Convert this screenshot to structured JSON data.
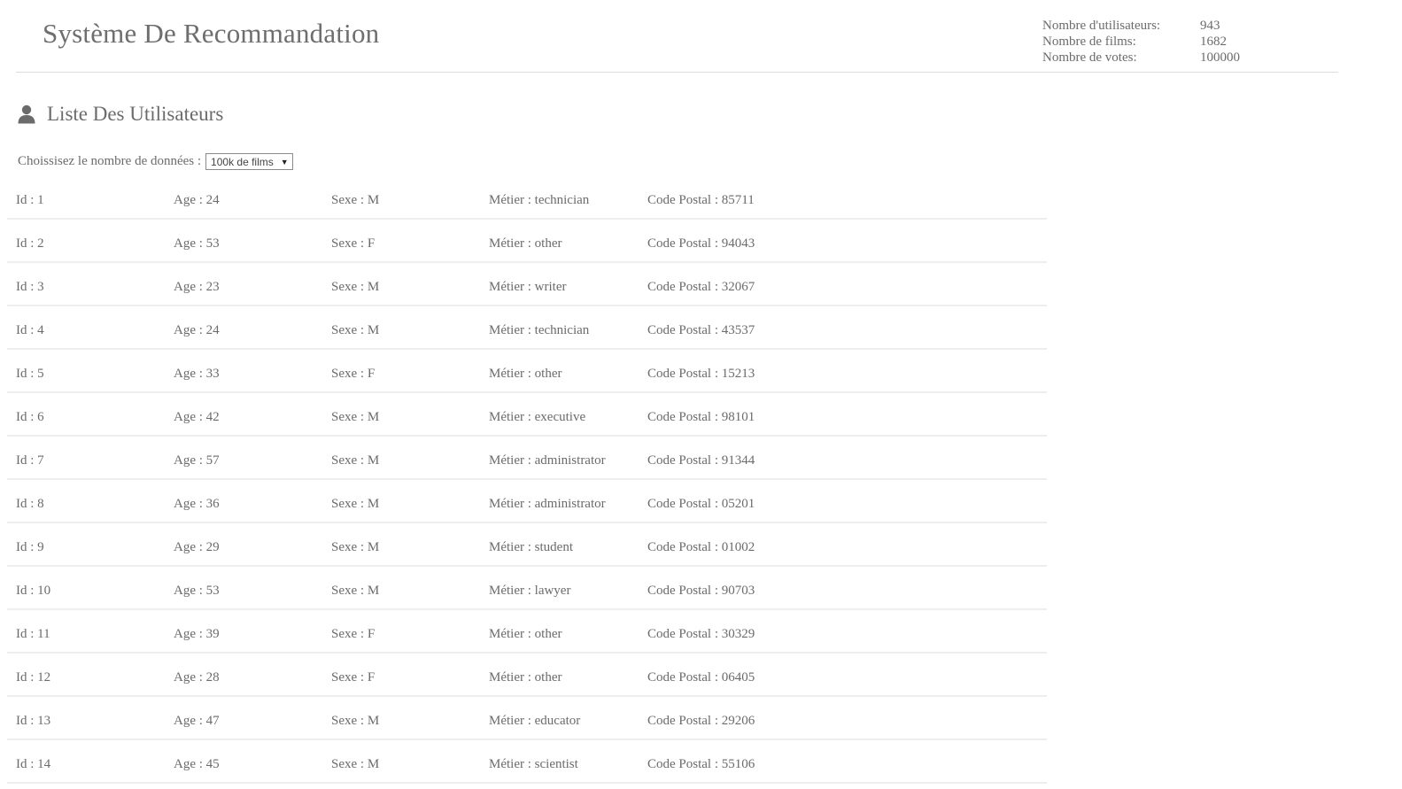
{
  "header": {
    "title": "Système De Recommandation",
    "stats": [
      {
        "label": "Nombre d'utilisateurs:",
        "value": "943"
      },
      {
        "label": "Nombre de films:",
        "value": "1682"
      },
      {
        "label": "Nombre de votes:",
        "value": "100000"
      }
    ]
  },
  "section": {
    "icon": "user-icon",
    "title": "Liste Des Utilisateurs",
    "select_label": "Choissisez le nombre de données :",
    "select_value": "100k de films"
  },
  "users": [
    {
      "id": "Id : 1",
      "age": "Age : 24",
      "sexe": "Sexe : M",
      "metier": "Métier : technician",
      "code_postal": "Code Postal : 85711"
    },
    {
      "id": "Id : 2",
      "age": "Age : 53",
      "sexe": "Sexe : F",
      "metier": "Métier : other",
      "code_postal": "Code Postal : 94043"
    },
    {
      "id": "Id : 3",
      "age": "Age : 23",
      "sexe": "Sexe : M",
      "metier": "Métier : writer",
      "code_postal": "Code Postal : 32067"
    },
    {
      "id": "Id : 4",
      "age": "Age : 24",
      "sexe": "Sexe : M",
      "metier": "Métier : technician",
      "code_postal": "Code Postal : 43537"
    },
    {
      "id": "Id : 5",
      "age": "Age : 33",
      "sexe": "Sexe : F",
      "metier": "Métier : other",
      "code_postal": "Code Postal : 15213"
    },
    {
      "id": "Id : 6",
      "age": "Age : 42",
      "sexe": "Sexe : M",
      "metier": "Métier : executive",
      "code_postal": "Code Postal : 98101"
    },
    {
      "id": "Id : 7",
      "age": "Age : 57",
      "sexe": "Sexe : M",
      "metier": "Métier : administrator",
      "code_postal": "Code Postal : 91344"
    },
    {
      "id": "Id : 8",
      "age": "Age : 36",
      "sexe": "Sexe : M",
      "metier": "Métier : administrator",
      "code_postal": "Code Postal : 05201"
    },
    {
      "id": "Id : 9",
      "age": "Age : 29",
      "sexe": "Sexe : M",
      "metier": "Métier : student",
      "code_postal": "Code Postal : 01002"
    },
    {
      "id": "Id : 10",
      "age": "Age : 53",
      "sexe": "Sexe : M",
      "metier": "Métier : lawyer",
      "code_postal": "Code Postal : 90703"
    },
    {
      "id": "Id : 11",
      "age": "Age : 39",
      "sexe": "Sexe : F",
      "metier": "Métier : other",
      "code_postal": "Code Postal : 30329"
    },
    {
      "id": "Id : 12",
      "age": "Age : 28",
      "sexe": "Sexe : F",
      "metier": "Métier : other",
      "code_postal": "Code Postal : 06405"
    },
    {
      "id": "Id : 13",
      "age": "Age : 47",
      "sexe": "Sexe : M",
      "metier": "Métier : educator",
      "code_postal": "Code Postal : 29206"
    },
    {
      "id": "Id : 14",
      "age": "Age : 45",
      "sexe": "Sexe : M",
      "metier": "Métier : scientist",
      "code_postal": "Code Postal : 55106"
    }
  ]
}
